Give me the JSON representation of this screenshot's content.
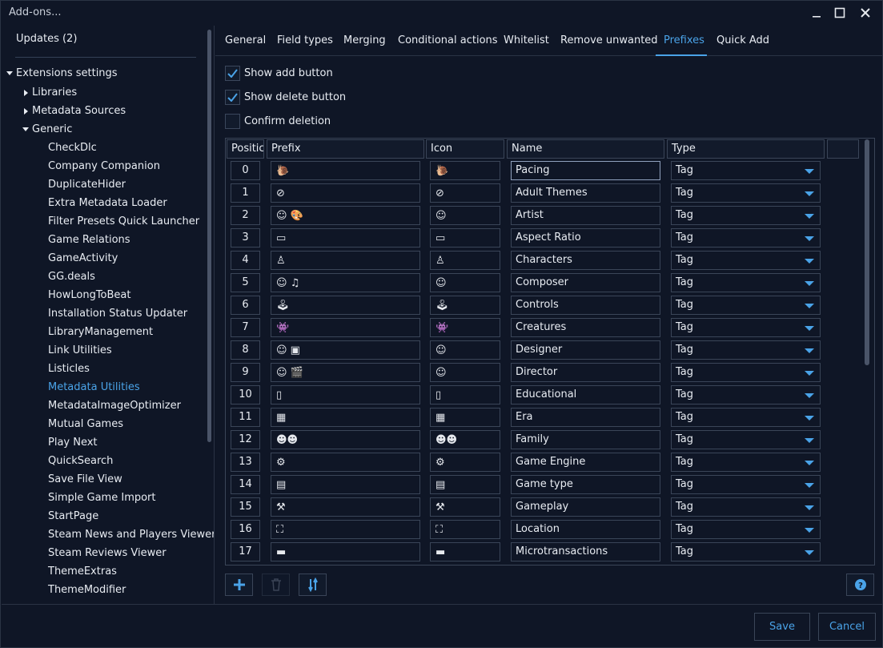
{
  "window": {
    "title": "Add-ons..."
  },
  "sidebar": {
    "updates_label": "Updates (2)",
    "extensions_settings": "Extensions settings",
    "groups": {
      "libraries": "Libraries",
      "metadata_sources": "Metadata Sources",
      "generic": "Generic"
    },
    "generic_items": [
      "CheckDlc",
      "Company Companion",
      "DuplicateHider",
      "Extra Metadata Loader",
      "Filter Presets Quick Launcher",
      "Game Relations",
      "GameActivity",
      "GG.deals",
      "HowLongToBeat",
      "Installation Status Updater",
      "LibraryManagement",
      "Link Utilities",
      "Listicles",
      "Metadata Utilities",
      "MetadataImageOptimizer",
      "Mutual Games",
      "Play Next",
      "QuickSearch",
      "Save File View",
      "Simple Game Import",
      "StartPage",
      "Steam News and Players Viewer",
      "Steam Reviews Viewer",
      "ThemeExtras",
      "ThemeModifier"
    ],
    "selected_item": "Metadata Utilities"
  },
  "tabs": [
    "General",
    "Field types",
    "Merging",
    "Conditional actions",
    "Whitelist",
    "Remove unwanted",
    "Prefixes",
    "Quick Add"
  ],
  "active_tab": "Prefixes",
  "options": {
    "show_add_button": {
      "label": "Show add button",
      "checked": true
    },
    "show_delete_button": {
      "label": "Show delete button",
      "checked": true
    },
    "confirm_deletion": {
      "label": "Confirm deletion",
      "checked": false
    }
  },
  "grid": {
    "headers": {
      "position": "Positic",
      "prefix": "Prefix",
      "icon": "Icon",
      "name": "Name",
      "type": "Type"
    },
    "rows": [
      {
        "position": "0",
        "prefix": "🐌",
        "icon": "🐌",
        "name": "Pacing",
        "type": "Tag"
      },
      {
        "position": "1",
        "prefix": "⊘",
        "icon": "⊘",
        "name": "Adult Themes",
        "type": "Tag"
      },
      {
        "position": "2",
        "prefix": "☺ 🎨",
        "icon": "☺",
        "name": "Artist",
        "type": "Tag"
      },
      {
        "position": "3",
        "prefix": "▭",
        "icon": "▭",
        "name": "Aspect Ratio",
        "type": "Tag"
      },
      {
        "position": "4",
        "prefix": "♙",
        "icon": "♙",
        "name": "Characters",
        "type": "Tag"
      },
      {
        "position": "5",
        "prefix": "☺ ♫",
        "icon": "☺",
        "name": "Composer",
        "type": "Tag"
      },
      {
        "position": "6",
        "prefix": "🕹",
        "icon": "🕹",
        "name": "Controls",
        "type": "Tag"
      },
      {
        "position": "7",
        "prefix": "👾",
        "icon": "👾",
        "name": "Creatures",
        "type": "Tag"
      },
      {
        "position": "8",
        "prefix": "☺ ▣",
        "icon": "☺",
        "name": "Designer",
        "type": "Tag"
      },
      {
        "position": "9",
        "prefix": "☺ 🎬",
        "icon": "☺",
        "name": "Director",
        "type": "Tag"
      },
      {
        "position": "10",
        "prefix": "▯",
        "icon": "▯",
        "name": "Educational",
        "type": "Tag"
      },
      {
        "position": "11",
        "prefix": "▦",
        "icon": "▦",
        "name": "Era",
        "type": "Tag"
      },
      {
        "position": "12",
        "prefix": "☻☻",
        "icon": "☻☻",
        "name": "Family",
        "type": "Tag"
      },
      {
        "position": "13",
        "prefix": "⚙",
        "icon": "⚙",
        "name": "Game Engine",
        "type": "Tag"
      },
      {
        "position": "14",
        "prefix": "▤",
        "icon": "▤",
        "name": "Game type",
        "type": "Tag"
      },
      {
        "position": "15",
        "prefix": "⚒",
        "icon": "⚒",
        "name": "Gameplay",
        "type": "Tag"
      },
      {
        "position": "16",
        "prefix": "⛶",
        "icon": "⛶",
        "name": "Location",
        "type": "Tag"
      },
      {
        "position": "17",
        "prefix": "▬",
        "icon": "▬",
        "name": "Microtransactions",
        "type": "Tag"
      }
    ]
  },
  "toolbar": {
    "add_icon": "add-icon",
    "delete_icon": "trash-icon",
    "sort_icon": "sort-icon",
    "help_icon": "help-icon"
  },
  "footer": {
    "save_label": "Save",
    "cancel_label": "Cancel"
  },
  "colors": {
    "accent": "#4aa3e8",
    "background": "#0f1626",
    "border": "#3a4558"
  }
}
